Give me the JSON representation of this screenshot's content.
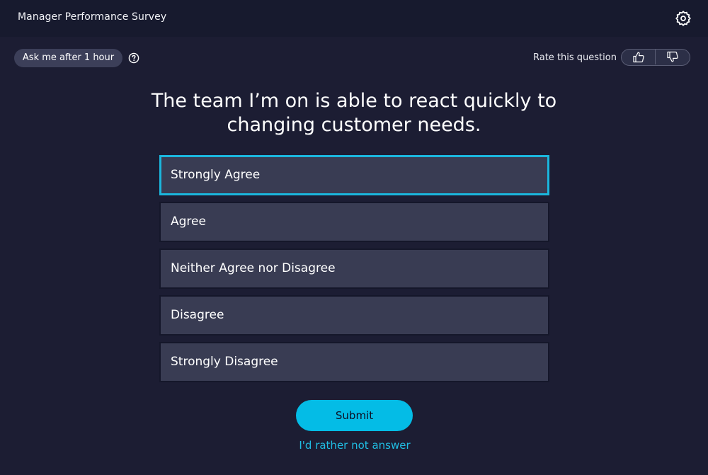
{
  "header": {
    "title": "Manager Performance Survey",
    "settings_icon": "gear-icon"
  },
  "toolbar": {
    "ask_later_label": "Ask me after 1 hour",
    "help_icon": "question-circle-icon",
    "rate_label": "Rate this question",
    "thumbs_up_icon": "thumbs-up-icon",
    "thumbs_down_icon": "thumbs-down-icon"
  },
  "question": {
    "text": "The team I’m on is able to react quickly to changing customer needs."
  },
  "options": [
    {
      "label": "Strongly Agree",
      "selected": true
    },
    {
      "label": "Agree",
      "selected": false
    },
    {
      "label": "Neither Agree nor Disagree",
      "selected": false
    },
    {
      "label": "Disagree",
      "selected": false
    },
    {
      "label": "Strongly Disagree",
      "selected": false
    }
  ],
  "actions": {
    "submit_label": "Submit",
    "skip_label": "I'd rather not answer"
  },
  "colors": {
    "background": "#1c1d33",
    "header": "#171a2e",
    "accent": "#04bce6",
    "option_bg": "#393c53",
    "selected_border": "#1bb6dd"
  }
}
